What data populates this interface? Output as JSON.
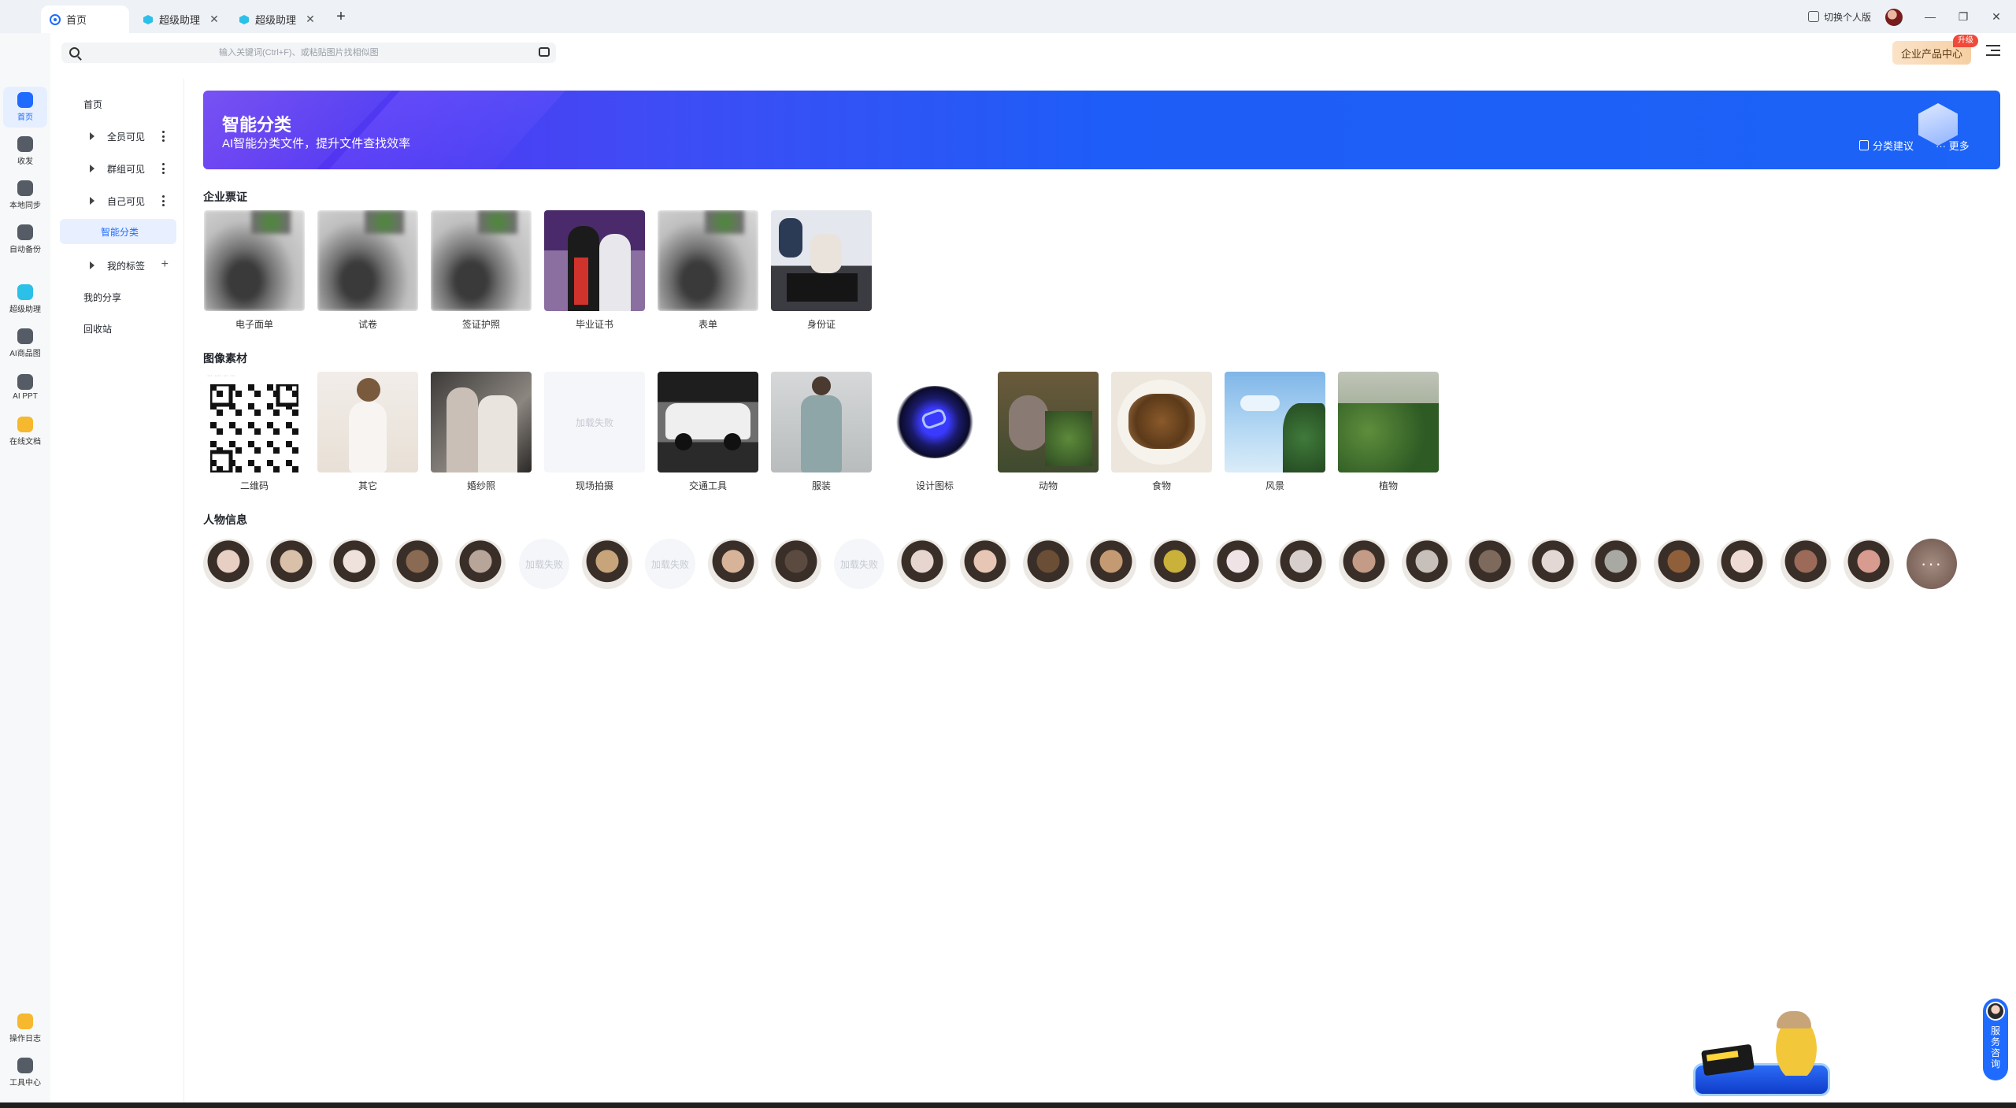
{
  "tabs": [
    {
      "label": "首页",
      "active": true,
      "icon": "cloud-drive-icon"
    },
    {
      "label": "超级助理",
      "active": false,
      "icon": "assistant-icon"
    },
    {
      "label": "超级助理",
      "active": false,
      "icon": "assistant-icon"
    }
  ],
  "titlebar": {
    "switch_personal": "切换个人版"
  },
  "search": {
    "placeholder": "输入关键词(Ctrl+F)、或粘贴图片找相似图"
  },
  "header": {
    "enterprise_center": "企业产品中心",
    "upgrade": "升级"
  },
  "rail": [
    {
      "label": "首页",
      "icon": "home-icon",
      "color": "#1f6bff",
      "active": true
    },
    {
      "label": "收发",
      "icon": "transfer-icon",
      "color": "#555c66",
      "active": false
    },
    {
      "label": "本地同步",
      "icon": "sync-icon",
      "color": "#555c66",
      "active": false
    },
    {
      "label": "自动备份",
      "icon": "backup-cloud-icon",
      "color": "#555c66",
      "active": false
    },
    {
      "label": "超级助理",
      "icon": "assistant-icon",
      "color": "#2ac0e8",
      "active": false
    },
    {
      "label": "AI商品图",
      "icon": "ai-product-image-icon",
      "color": "#555c66",
      "active": false
    },
    {
      "label": "AI PPT",
      "icon": "ai-ppt-icon",
      "color": "#555c66",
      "active": false
    },
    {
      "label": "在线文档",
      "icon": "online-doc-icon",
      "color": "#f5b82e",
      "active": false
    },
    {
      "label": "操作日志",
      "icon": "operation-log-icon",
      "color": "#f5b82e",
      "active": false
    },
    {
      "label": "工具中心",
      "icon": "tool-center-icon",
      "color": "#555c66",
      "active": false
    }
  ],
  "nav": {
    "home": "首页",
    "public": "全员可见",
    "group": "群组可见",
    "self": "自己可见",
    "smart": "智能分类",
    "tags": "我的标签",
    "shares": "我的分享",
    "recycle": "回收站"
  },
  "banner": {
    "title": "智能分类",
    "subtitle": "AI智能分类文件，提升文件查找效率",
    "suggest": "分类建议",
    "more": "更多"
  },
  "sections": {
    "docs": {
      "title": "企业票证",
      "items": [
        "电子面单",
        "试卷",
        "签证护照",
        "毕业证书",
        "表单",
        "身份证"
      ]
    },
    "images": {
      "title": "图像素材",
      "items": [
        "二维码",
        "其它",
        "婚纱照",
        "现场拍摄",
        "交通工具",
        "服装",
        "设计图标",
        "动物",
        "食物",
        "风景",
        "植物"
      ]
    },
    "people": {
      "title": "人物信息",
      "fail_text": "加载失败",
      "faces": [
        {
          "status": "ok",
          "tone": "#e8cfc3"
        },
        {
          "status": "ok",
          "tone": "#d9c0a8"
        },
        {
          "status": "ok",
          "tone": "#efe2dc"
        },
        {
          "status": "ok",
          "tone": "#8a6a52"
        },
        {
          "status": "ok",
          "tone": "#b7a59a"
        },
        {
          "status": "fail"
        },
        {
          "status": "ok",
          "tone": "#c7a47a"
        },
        {
          "status": "fail"
        },
        {
          "status": "ok",
          "tone": "#d7b39a"
        },
        {
          "status": "ok",
          "tone": "#5b4a40"
        },
        {
          "status": "fail"
        },
        {
          "status": "ok",
          "tone": "#e6d6cf"
        },
        {
          "status": "ok",
          "tone": "#e7c6b5"
        },
        {
          "status": "ok",
          "tone": "#6b4e36"
        },
        {
          "status": "ok",
          "tone": "#c49a72"
        },
        {
          "status": "ok",
          "tone": "#c9b13a"
        },
        {
          "status": "ok",
          "tone": "#efe3e6"
        },
        {
          "status": "ok",
          "tone": "#d7cfcc"
        },
        {
          "status": "ok",
          "tone": "#c39b86"
        },
        {
          "status": "ok",
          "tone": "#c7bfb9"
        },
        {
          "status": "ok",
          "tone": "#7e6a5c"
        },
        {
          "status": "ok",
          "tone": "#e3d8d3"
        },
        {
          "status": "ok",
          "tone": "#a9a9a4"
        },
        {
          "status": "ok",
          "tone": "#8f5f3a"
        },
        {
          "status": "ok",
          "tone": "#eedbd4"
        },
        {
          "status": "ok",
          "tone": "#9c6a58"
        },
        {
          "status": "ok",
          "tone": "#d79b8f"
        }
      ]
    }
  },
  "floating": {
    "service": [
      "服",
      "务",
      "咨",
      "询"
    ]
  }
}
